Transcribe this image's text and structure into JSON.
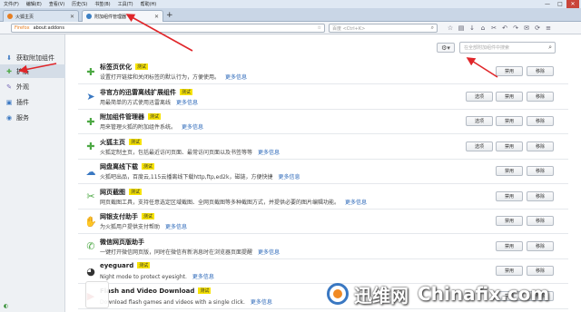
{
  "window": {
    "menu": [
      "文件(F)",
      "编辑(E)",
      "查看(V)",
      "历史(S)",
      "书签(B)",
      "工具(T)",
      "帮助(H)"
    ],
    "controls": [
      "—",
      "□",
      "✕"
    ]
  },
  "tabs": [
    {
      "label": "火狐主页",
      "close": "✕"
    },
    {
      "label": "附加组件管理器",
      "close": "✕"
    }
  ],
  "new_tab": "+",
  "navbar": {
    "url_brand": "Firefox",
    "url": "about:addons",
    "url_go": "☆",
    "search_placeholder": "百度 <Ctrl+K>",
    "search_icon": "search-icon"
  },
  "sidebar": {
    "items": [
      {
        "label": "获取附加组件",
        "icon": "download-icon"
      },
      {
        "label": "扩展",
        "icon": "puzzle-icon"
      },
      {
        "label": "外观",
        "icon": "brush-icon"
      },
      {
        "label": "插件",
        "icon": "plugin-icon"
      },
      {
        "label": "服务",
        "icon": "service-icon"
      }
    ]
  },
  "toolbar": {
    "gear": "⚙▾",
    "search_placeholder": "在全部附加组件中搜索"
  },
  "buttons": {
    "options": "选项",
    "disable": "禁用",
    "remove": "移除"
  },
  "addons": [
    {
      "name": "标签页优化",
      "badge": "测试",
      "desc": "设置打开链接和关闭标签的默认行为，方便使用。",
      "more": "更多信息",
      "has_options": false
    },
    {
      "name": "非官方的迅雷离线扩展组件",
      "badge": "测试",
      "desc": "用最简单的方式使用迅雷离线",
      "more": "更多信息",
      "has_options": true
    },
    {
      "name": "附加组件管理器",
      "badge": "测试",
      "desc": "用来管理火狐的附加组件系统。",
      "more": "更多信息",
      "has_options": true
    },
    {
      "name": "火狐主页",
      "badge": "测试",
      "desc": "火狐定制主页，包括最近访问页面、最常访问页面以及书签等等",
      "more": "更多信息",
      "has_options": true
    },
    {
      "name": "网盘离线下载",
      "badge": "测试",
      "desc": "火狐吧出品，百度云,115云播离线下载http,ftp,ed2k，磁链，方便快捷",
      "more": "更多信息",
      "has_options": false
    },
    {
      "name": "网页截图",
      "badge": "测试",
      "desc": "网页截图工具，支持任意选定区域截图、全网页截图等多种截图方式，并提供必要的图片编辑功能。",
      "more": "更多信息",
      "has_options": false
    },
    {
      "name": "网银支付助手",
      "badge": "测试",
      "desc": "为火狐用户提供支付帮助",
      "more": "更多信息",
      "has_options": false
    },
    {
      "name": "微信网页版助手",
      "badge": "",
      "desc": "一键打开微信网页版，同时在微信有新消息时在浏览器页面提醒",
      "more": "更多信息",
      "has_options": false
    },
    {
      "name": "eyeguard",
      "badge": "测试",
      "desc": "Night mode to protect eyesight.",
      "more": "更多信息",
      "has_options": false
    },
    {
      "name": "Flash and Video Download",
      "badge": "测试",
      "desc": "Download flash games and videos with a single click.",
      "more": "更多信息",
      "has_options": false
    }
  ],
  "watermark": {
    "cn": "迅维网",
    "en": "Chinafix.com"
  }
}
